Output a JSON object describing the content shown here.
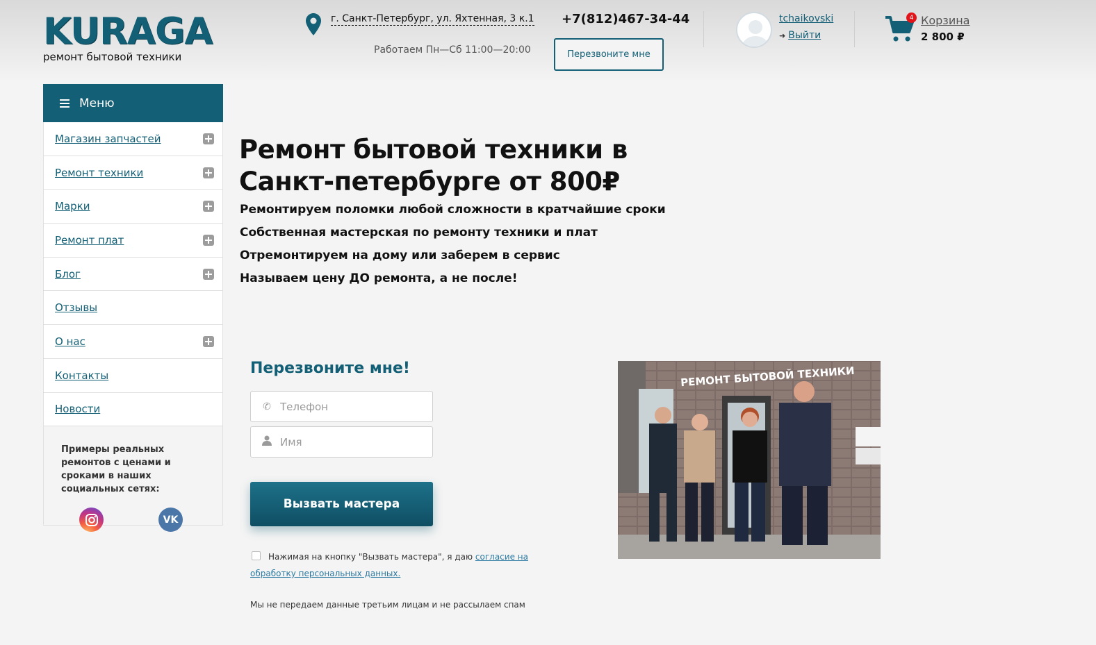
{
  "header": {
    "logo": "KURAGA",
    "tagline": "ремонт бытовой техники",
    "address": "г. Санкт-Петербург, ул. Яхтенная, 3 к.1",
    "hours": "Работаем Пн—Сб 11:00—20:00",
    "phone": "+7(812)467-34-44",
    "callback_label": "Перезвоните мне",
    "user": {
      "name": "tchaikovski",
      "logout_label": "Выйти"
    },
    "cart": {
      "label": "Корзина",
      "total": "2 800 ₽",
      "count": "4"
    }
  },
  "sidebar": {
    "menu_label": "Меню",
    "items": [
      {
        "label": "Магазин запчастей",
        "expandable": true
      },
      {
        "label": "Ремонт техники",
        "expandable": true
      },
      {
        "label": "Марки",
        "expandable": true
      },
      {
        "label": "Ремонт плат",
        "expandable": true
      },
      {
        "label": "Блог",
        "expandable": true
      },
      {
        "label": "Отзывы",
        "expandable": false
      },
      {
        "label": "О нас",
        "expandable": true
      },
      {
        "label": "Контакты",
        "expandable": false
      },
      {
        "label": "Новости",
        "expandable": false
      }
    ],
    "social_text": "Примеры реальных ремонтов с ценами и сроками в наших социальных сетях:",
    "social_icons": [
      "instagram-icon",
      "vk-icon"
    ],
    "vk_glyph": "VK"
  },
  "hero": {
    "title": "Ремонт бытовой техники в Санкт-петербурге от 800₽",
    "lines": [
      "Ремонтируем поломки любой сложности в кратчайшие сроки",
      "Собственная мастерская по ремонту техники и плат",
      "Отремонтируем на дому или заберем в сервис",
      "Называем цену ДО ремонта, а не после!"
    ]
  },
  "form": {
    "title": "Перезвоните мне!",
    "phone_placeholder": "Телефон",
    "name_placeholder": "Имя",
    "phone_value": "",
    "name_value": "",
    "submit_label": "Вызвать мастера",
    "consent_text": "Нажимая на кнопку \"Вызвать мастера\", я даю",
    "consent_link": "согласие на обработку персональных данных.",
    "consent_checked": false,
    "no_spam": "Мы не передаем данные третьим лицам и не рассылаем спам"
  },
  "photo": {
    "sign": "РЕМОНТ БЫТОВОЙ ТЕХНИКИ"
  },
  "colors": {
    "brand": "#135f75",
    "background": "#f4f4f4",
    "badge": "#e2141a",
    "link": "#2c7aa1"
  }
}
